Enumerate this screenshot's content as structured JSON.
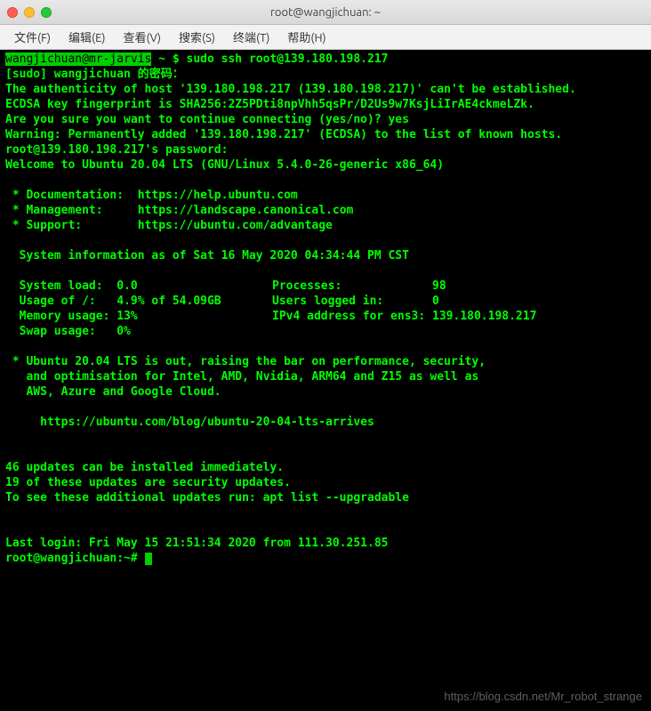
{
  "titlebar": {
    "title": "root@wangjichuan: ~"
  },
  "menubar": {
    "file": "文件(F)",
    "edit": "编辑(E)",
    "view": "查看(V)",
    "search": "搜索(S)",
    "terminal": "终端(T)",
    "help": "帮助(H)"
  },
  "terminal": {
    "prompt_user": "wangjichuan@mr-jarvis",
    "prompt_sep": " ~ $ ",
    "command": "sudo ssh root@139.180.198.217",
    "sudo_prompt": "[sudo] wangjichuan 的密码：",
    "auth_line": "The authenticity of host '139.180.198.217 (139.180.198.217)' can't be established.",
    "fingerprint": "ECDSA key fingerprint is SHA256:2Z5PDti8npVhh5qsPr/D2Us9w7KsjLiIrAE4ckmeLZk.",
    "confirm": "Are you sure you want to continue connecting (yes/no)? yes",
    "warning": "Warning: Permanently added '139.180.198.217' (ECDSA) to the list of known hosts.",
    "password": "root@139.180.198.217's password:",
    "welcome": "Welcome to Ubuntu 20.04 LTS (GNU/Linux 5.4.0-26-generic x86_64)",
    "doc_label": " * Documentation:  ",
    "doc_url": "https://help.ubuntu.com",
    "mgmt_label": " * Management:     ",
    "mgmt_url": "https://landscape.canonical.com",
    "sup_label": " * Support:        ",
    "sup_url": "https://ubuntu.com/advantage",
    "sysinfo_header": "  System information as of Sat 16 May 2020 04:34:44 PM CST",
    "sys_load_l": "  System load:  0.0",
    "sys_load_r": "Processes:             98",
    "usage_l": "  Usage of /:   4.9% of 54.09GB",
    "usage_r": "Users logged in:       0",
    "mem_l": "  Memory usage: 13%",
    "mem_r": "IPv4 address for ens3: 139.180.198.217",
    "swap_l": "  Swap usage:   0%",
    "motd1": " * Ubuntu 20.04 LTS is out, raising the bar on performance, security,",
    "motd2": "   and optimisation for Intel, AMD, Nvidia, ARM64 and Z15 as well as",
    "motd3": "   AWS, Azure and Google Cloud.",
    "motd_url": "     https://ubuntu.com/blog/ubuntu-20-04-lts-arrives",
    "updates1": "46 updates can be installed immediately.",
    "updates2": "19 of these updates are security updates.",
    "updates3": "To see these additional updates run: apt list --upgradable",
    "lastlogin": "Last login: Fri May 15 21:51:34 2020 from 111.30.251.85",
    "prompt2": "root@wangjichuan:~# "
  },
  "watermark": "https://blog.csdn.net/Mr_robot_strange"
}
